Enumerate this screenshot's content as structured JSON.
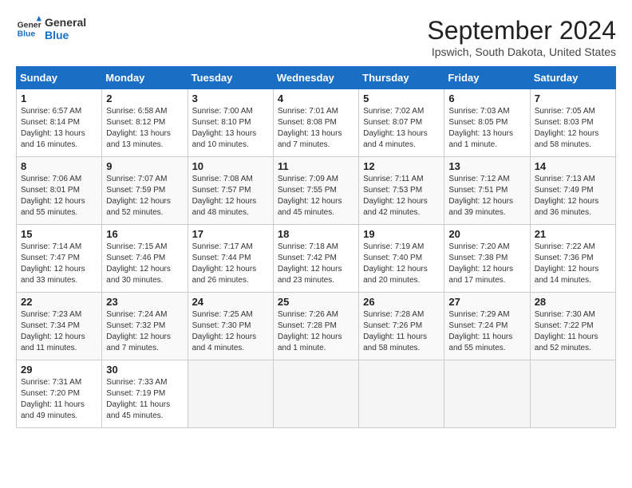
{
  "logo": {
    "line1": "General",
    "line2": "Blue"
  },
  "title": "September 2024",
  "location": "Ipswich, South Dakota, United States",
  "days_of_week": [
    "Sunday",
    "Monday",
    "Tuesday",
    "Wednesday",
    "Thursday",
    "Friday",
    "Saturday"
  ],
  "weeks": [
    [
      {
        "day": "1",
        "info": "Sunrise: 6:57 AM\nSunset: 8:14 PM\nDaylight: 13 hours\nand 16 minutes."
      },
      {
        "day": "2",
        "info": "Sunrise: 6:58 AM\nSunset: 8:12 PM\nDaylight: 13 hours\nand 13 minutes."
      },
      {
        "day": "3",
        "info": "Sunrise: 7:00 AM\nSunset: 8:10 PM\nDaylight: 13 hours\nand 10 minutes."
      },
      {
        "day": "4",
        "info": "Sunrise: 7:01 AM\nSunset: 8:08 PM\nDaylight: 13 hours\nand 7 minutes."
      },
      {
        "day": "5",
        "info": "Sunrise: 7:02 AM\nSunset: 8:07 PM\nDaylight: 13 hours\nand 4 minutes."
      },
      {
        "day": "6",
        "info": "Sunrise: 7:03 AM\nSunset: 8:05 PM\nDaylight: 13 hours\nand 1 minute."
      },
      {
        "day": "7",
        "info": "Sunrise: 7:05 AM\nSunset: 8:03 PM\nDaylight: 12 hours\nand 58 minutes."
      }
    ],
    [
      {
        "day": "8",
        "info": "Sunrise: 7:06 AM\nSunset: 8:01 PM\nDaylight: 12 hours\nand 55 minutes."
      },
      {
        "day": "9",
        "info": "Sunrise: 7:07 AM\nSunset: 7:59 PM\nDaylight: 12 hours\nand 52 minutes."
      },
      {
        "day": "10",
        "info": "Sunrise: 7:08 AM\nSunset: 7:57 PM\nDaylight: 12 hours\nand 48 minutes."
      },
      {
        "day": "11",
        "info": "Sunrise: 7:09 AM\nSunset: 7:55 PM\nDaylight: 12 hours\nand 45 minutes."
      },
      {
        "day": "12",
        "info": "Sunrise: 7:11 AM\nSunset: 7:53 PM\nDaylight: 12 hours\nand 42 minutes."
      },
      {
        "day": "13",
        "info": "Sunrise: 7:12 AM\nSunset: 7:51 PM\nDaylight: 12 hours\nand 39 minutes."
      },
      {
        "day": "14",
        "info": "Sunrise: 7:13 AM\nSunset: 7:49 PM\nDaylight: 12 hours\nand 36 minutes."
      }
    ],
    [
      {
        "day": "15",
        "info": "Sunrise: 7:14 AM\nSunset: 7:47 PM\nDaylight: 12 hours\nand 33 minutes."
      },
      {
        "day": "16",
        "info": "Sunrise: 7:15 AM\nSunset: 7:46 PM\nDaylight: 12 hours\nand 30 minutes."
      },
      {
        "day": "17",
        "info": "Sunrise: 7:17 AM\nSunset: 7:44 PM\nDaylight: 12 hours\nand 26 minutes."
      },
      {
        "day": "18",
        "info": "Sunrise: 7:18 AM\nSunset: 7:42 PM\nDaylight: 12 hours\nand 23 minutes."
      },
      {
        "day": "19",
        "info": "Sunrise: 7:19 AM\nSunset: 7:40 PM\nDaylight: 12 hours\nand 20 minutes."
      },
      {
        "day": "20",
        "info": "Sunrise: 7:20 AM\nSunset: 7:38 PM\nDaylight: 12 hours\nand 17 minutes."
      },
      {
        "day": "21",
        "info": "Sunrise: 7:22 AM\nSunset: 7:36 PM\nDaylight: 12 hours\nand 14 minutes."
      }
    ],
    [
      {
        "day": "22",
        "info": "Sunrise: 7:23 AM\nSunset: 7:34 PM\nDaylight: 12 hours\nand 11 minutes."
      },
      {
        "day": "23",
        "info": "Sunrise: 7:24 AM\nSunset: 7:32 PM\nDaylight: 12 hours\nand 7 minutes."
      },
      {
        "day": "24",
        "info": "Sunrise: 7:25 AM\nSunset: 7:30 PM\nDaylight: 12 hours\nand 4 minutes."
      },
      {
        "day": "25",
        "info": "Sunrise: 7:26 AM\nSunset: 7:28 PM\nDaylight: 12 hours\nand 1 minute."
      },
      {
        "day": "26",
        "info": "Sunrise: 7:28 AM\nSunset: 7:26 PM\nDaylight: 11 hours\nand 58 minutes."
      },
      {
        "day": "27",
        "info": "Sunrise: 7:29 AM\nSunset: 7:24 PM\nDaylight: 11 hours\nand 55 minutes."
      },
      {
        "day": "28",
        "info": "Sunrise: 7:30 AM\nSunset: 7:22 PM\nDaylight: 11 hours\nand 52 minutes."
      }
    ],
    [
      {
        "day": "29",
        "info": "Sunrise: 7:31 AM\nSunset: 7:20 PM\nDaylight: 11 hours\nand 49 minutes."
      },
      {
        "day": "30",
        "info": "Sunrise: 7:33 AM\nSunset: 7:19 PM\nDaylight: 11 hours\nand 45 minutes."
      },
      {
        "day": "",
        "info": ""
      },
      {
        "day": "",
        "info": ""
      },
      {
        "day": "",
        "info": ""
      },
      {
        "day": "",
        "info": ""
      },
      {
        "day": "",
        "info": ""
      }
    ]
  ]
}
